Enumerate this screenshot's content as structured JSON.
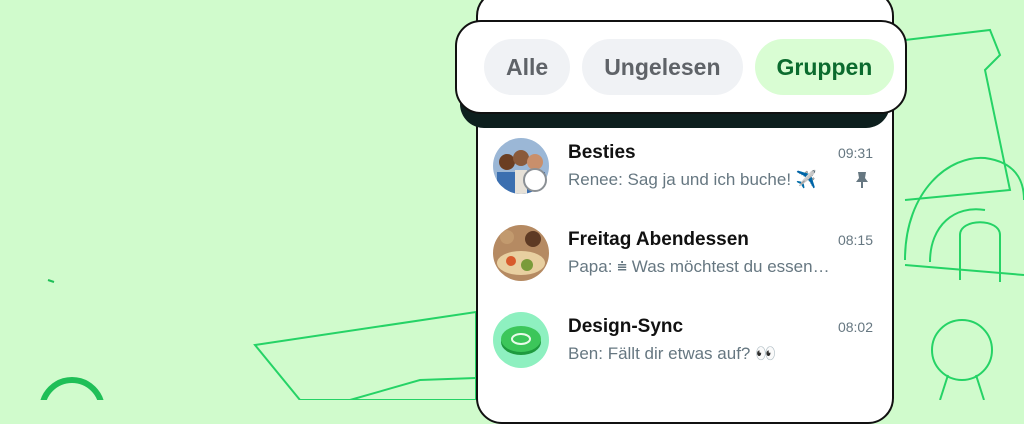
{
  "filters": [
    {
      "label": "Alle",
      "active": false
    },
    {
      "label": "Ungelesen",
      "active": false
    },
    {
      "label": "Gruppen",
      "active": true
    }
  ],
  "chats": [
    {
      "name": "Besties",
      "time": "09:31",
      "preview": "Renee: Sag ja und ich buche! ✈️",
      "pinned": true,
      "avatar_icon": "group-photo-icon"
    },
    {
      "name": "Freitag Abendessen",
      "time": "08:15",
      "preview": "Papa: ⩧ Was möchtest du essen…",
      "pinned": false,
      "avatar_icon": "dinner-photo-icon"
    },
    {
      "name": "Design-Sync",
      "time": "08:02",
      "preview": "Ben: Fällt dir etwas auf? 👀",
      "pinned": false,
      "avatar_icon": "disc-icon"
    }
  ],
  "colors": {
    "background": "#d0fbcc",
    "accent": "#25d366",
    "chip_active_bg": "#d9fdd3",
    "chip_active_text": "#0b6b2e"
  }
}
